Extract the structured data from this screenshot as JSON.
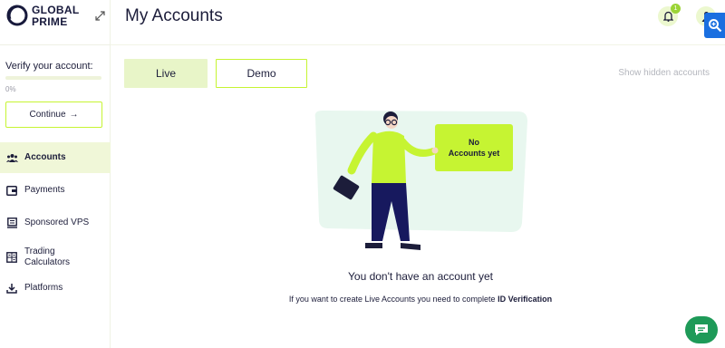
{
  "brand": {
    "line1": "GLOBAL",
    "line2": "PRIME"
  },
  "sidebar": {
    "verify_label": "Verify your account:",
    "progress_percent": 0,
    "progress_text": "0%",
    "continue_label": "Continue",
    "items": [
      {
        "label": "Accounts",
        "icon": "accounts-icon",
        "active": true
      },
      {
        "label": "Payments",
        "icon": "wallet-icon",
        "active": false
      },
      {
        "label": "Sponsored VPS",
        "icon": "server-icon",
        "active": false
      },
      {
        "label": "Trading Calculators",
        "icon": "calculator-icon",
        "active": false
      },
      {
        "label": "Platforms",
        "icon": "download-icon",
        "active": false
      }
    ]
  },
  "header": {
    "title": "My Accounts",
    "notifications_count": "1"
  },
  "tabs": [
    {
      "label": "Live",
      "selected": true
    },
    {
      "label": "Demo",
      "selected": false
    }
  ],
  "show_hidden_label": "Show hidden accounts",
  "empty_state": {
    "board_line1": "No",
    "board_line2": "Accounts yet",
    "title": "You don't have an account yet",
    "subtitle_prefix": "If you want to create Live Accounts you need to complete",
    "subtitle_link": "ID Verification"
  },
  "colors": {
    "accent": "#c6f432",
    "accent_light": "#e8f5c8",
    "text": "#1c1d3a",
    "chat": "#1e9a58",
    "zoom": "#1a6fe0"
  }
}
